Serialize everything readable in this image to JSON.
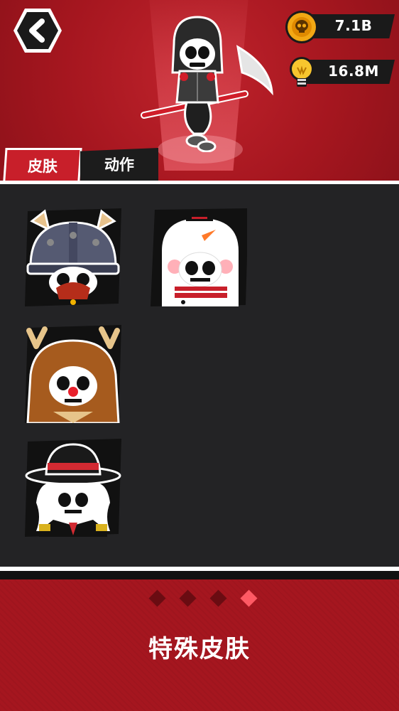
{
  "currency": {
    "coins": "7.1B",
    "ideas": "16.8M"
  },
  "tabs": [
    {
      "label": "皮肤",
      "active": true
    },
    {
      "label": "动作",
      "active": false
    }
  ],
  "skins": [
    {
      "name": "viking-skin"
    },
    {
      "name": "snowman-skin"
    },
    {
      "name": "reindeer-skin"
    },
    {
      "name": "mafia-skin"
    }
  ],
  "pagination": {
    "total": 4,
    "current": 4
  },
  "page_title": "特殊皮肤",
  "colors": {
    "primary_red": "#a5161f",
    "active_tab": "#c81f2a",
    "dot_active": "#ff5a64",
    "dot_inactive": "#6a0c12",
    "panel": "#232325"
  }
}
